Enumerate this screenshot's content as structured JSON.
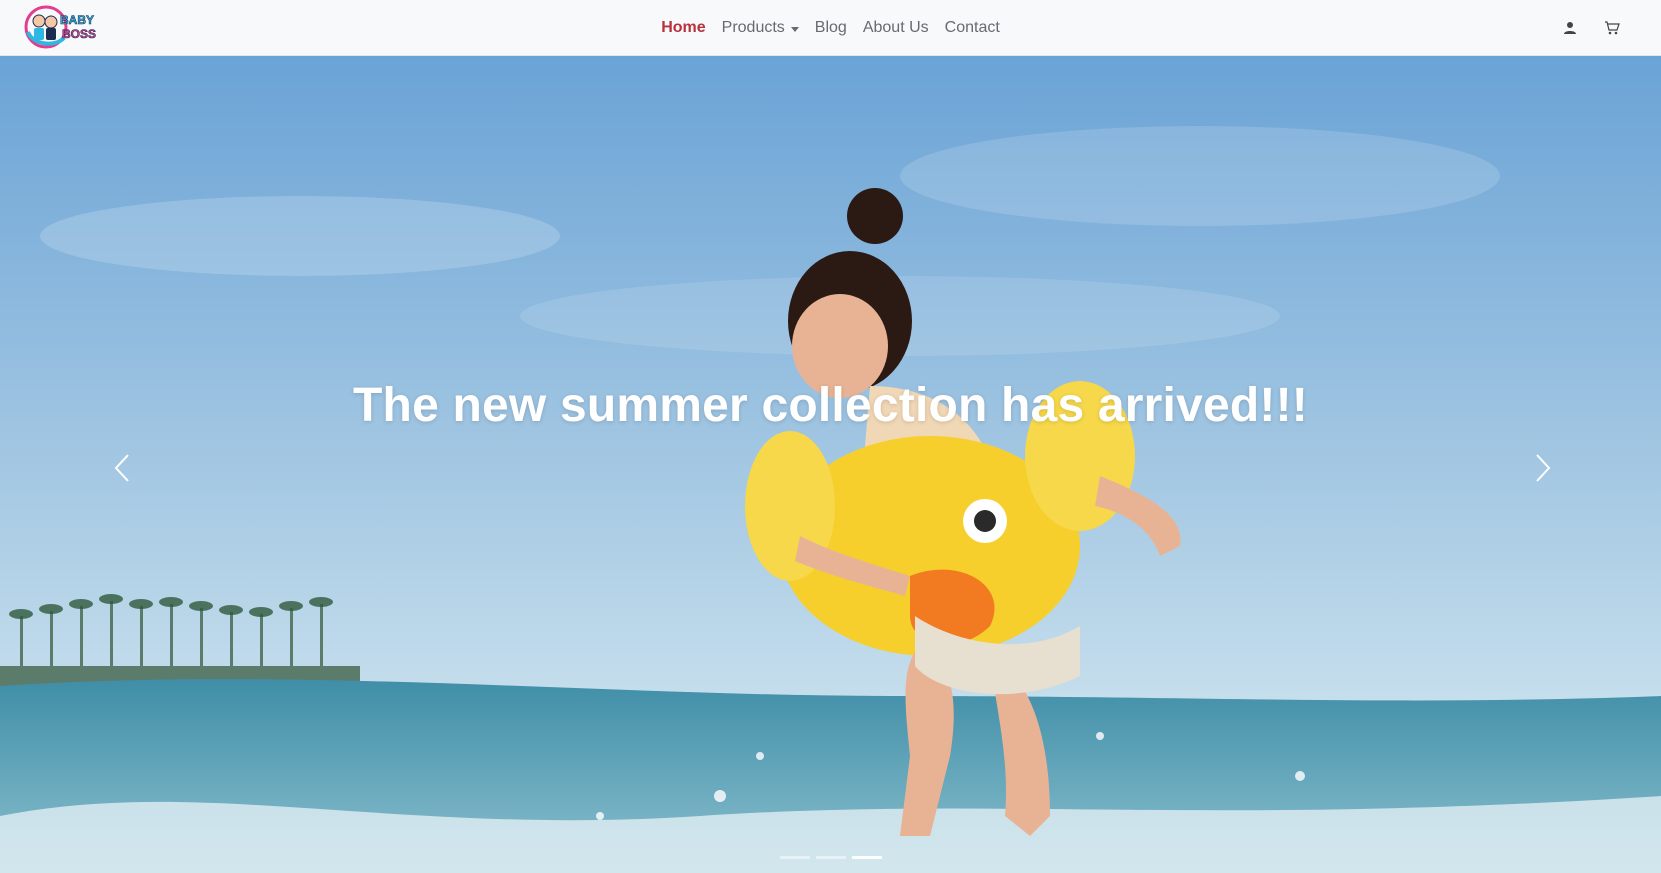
{
  "brand": {
    "logo_text_line1": "BABY",
    "logo_text_line2": "BOSS",
    "colors": {
      "pink": "#e23d8f",
      "blue": "#2fb7e3",
      "dark": "#1b2c52"
    }
  },
  "nav": {
    "items": [
      {
        "label": "Home",
        "active": true
      },
      {
        "label": "Products",
        "dropdown": true
      },
      {
        "label": "Blog"
      },
      {
        "label": "About Us"
      },
      {
        "label": "Contact"
      }
    ],
    "active_color": "#b8323e",
    "icons": [
      "user-icon",
      "cart-icon"
    ]
  },
  "hero": {
    "caption": "The new summer collection has arrived!!!",
    "controls": {
      "prev_icon": "chevron-left-icon",
      "next_icon": "chevron-right-icon"
    },
    "slides_count": 3,
    "active_slide": 3,
    "scene": {
      "sky_top": "#6aa3d6",
      "sky_bottom": "#cde3ef",
      "sea": "#5f9fb1",
      "float_yellow": "#f7cf2c"
    }
  }
}
